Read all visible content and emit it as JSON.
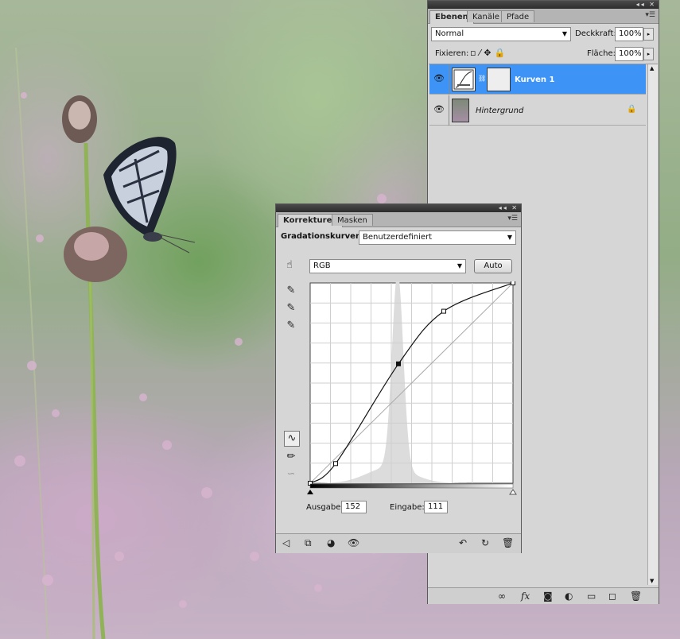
{
  "layers_panel": {
    "tabs": [
      {
        "label": "Ebenen",
        "active": true
      },
      {
        "label": "Kanäle",
        "active": false
      },
      {
        "label": "Pfade",
        "active": false
      }
    ],
    "blend_mode": "Normal",
    "opacity_label": "Deckkraft:",
    "opacity_value": "100%",
    "lock_label": "Fixieren:",
    "fill_label": "Fläche:",
    "fill_value": "100%",
    "layers": [
      {
        "name": "Kurven 1",
        "selected": true,
        "visible": true
      },
      {
        "name": "Hintergrund",
        "selected": false,
        "visible": true,
        "locked": true
      }
    ],
    "footer_icons": [
      "link-icon",
      "fx-icon",
      "mask-icon",
      "adjustment-icon",
      "group-folder-icon",
      "new-layer-icon",
      "trash-icon"
    ]
  },
  "adjustments_panel": {
    "tabs": [
      {
        "label": "Korrekturen",
        "active": true
      },
      {
        "label": "Masken",
        "active": false
      }
    ],
    "title": "Gradationskurven",
    "preset": "Benutzerdefiniert",
    "channel": "RGB",
    "auto_label": "Auto",
    "output_label": "Ausgabe:",
    "output_value": "152",
    "input_label": "Eingabe:",
    "input_value": "111",
    "footer_icons": [
      "back-arrow-icon",
      "clip-icon",
      "visibility-icon",
      "eye-icon",
      "reset-previous-icon",
      "reset-icon",
      "trash-icon"
    ]
  },
  "colors": {
    "selected_layer": "#3d94f6",
    "panel_bg": "#d6d6d6",
    "histogram": "#dcdcdc"
  },
  "chart_data": {
    "type": "line",
    "title": "",
    "xlabel": "Eingabe",
    "ylabel": "Ausgabe",
    "xlim": [
      0,
      255
    ],
    "ylim": [
      0,
      255
    ],
    "grid": true,
    "curve_points": [
      [
        0,
        0
      ],
      [
        32,
        25
      ],
      [
        111,
        152
      ],
      [
        168,
        219
      ],
      [
        255,
        255
      ]
    ],
    "active_point": [
      111,
      152
    ]
  }
}
